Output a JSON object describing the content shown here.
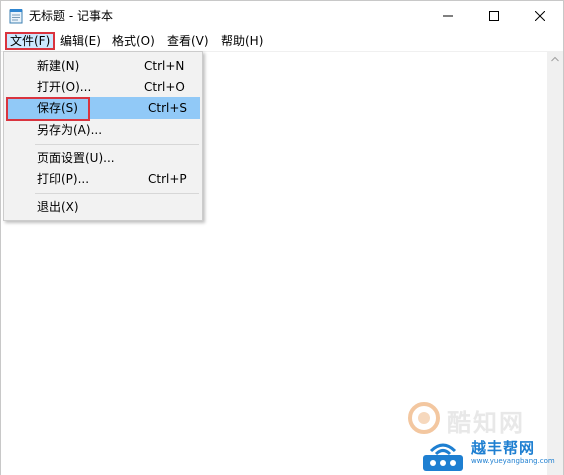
{
  "window": {
    "title": "无标题 - 记事本"
  },
  "menubar": {
    "items": [
      {
        "label": "文件(F)"
      },
      {
        "label": "编辑(E)"
      },
      {
        "label": "格式(O)"
      },
      {
        "label": "查看(V)"
      },
      {
        "label": "帮助(H)"
      }
    ]
  },
  "file_menu": {
    "items": [
      {
        "label": "新建(N)",
        "accel": "Ctrl+N"
      },
      {
        "label": "打开(O)...",
        "accel": "Ctrl+O"
      },
      {
        "label": "保存(S)",
        "accel": "Ctrl+S",
        "highlighted": true
      },
      {
        "label": "另存为(A)...",
        "accel": ""
      },
      {
        "label": "页面设置(U)...",
        "accel": ""
      },
      {
        "label": "打印(P)...",
        "accel": "Ctrl+P"
      },
      {
        "label": "退出(X)",
        "accel": ""
      }
    ]
  },
  "watermarks": {
    "site1": "酷知网",
    "site2": "越丰帮网",
    "site2_url": "www.yueyangbang.com"
  },
  "colors": {
    "menu_highlight": "#91c9f7",
    "annotation_red": "#d9343f",
    "menu_background": "#f2f2f2"
  }
}
